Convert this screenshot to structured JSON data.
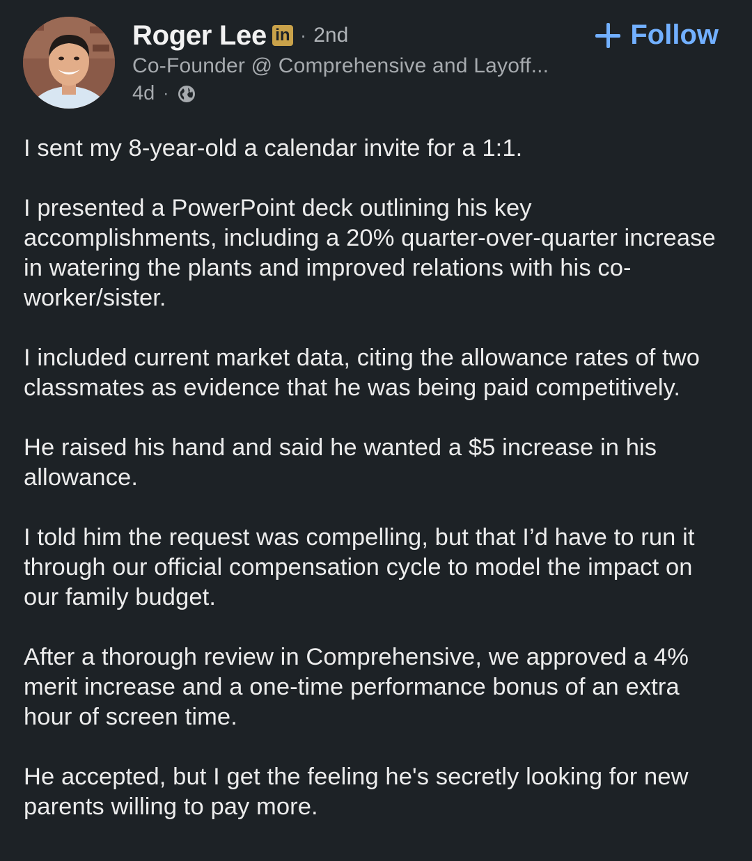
{
  "author": {
    "name": "Roger Lee",
    "badge": "in",
    "degree": "2nd",
    "headline": "Co-Founder @ Comprehensive and Layoff...",
    "time": "4d",
    "visibility_icon": "globe-icon"
  },
  "follow": {
    "label": "Follow",
    "icon": "plus-icon",
    "color": "#72b0ff"
  },
  "separator": "·",
  "post": {
    "paragraphs": [
      "I sent my 8-year-old a calendar invite for a 1:1.",
      "I presented a PowerPoint deck outlining his key accomplishments, including a 20% quarter-over-quarter increase in watering the plants and improved relations with his co-worker/sister.",
      "I included current market data, citing the allowance rates of two classmates as evidence that he was being paid competitively.",
      "He raised his hand and said he wanted a $5 increase in his allowance.",
      "I told him the request was compelling, but that I’d have to run it through our official compensation cycle to model the impact on our family budget.",
      "After a thorough review in Comprehensive, we approved a 4% merit increase and a one-time performance bonus of an extra hour of screen time.",
      "He accepted, but I get the feeling he's secretly looking for new parents willing to pay more."
    ]
  },
  "theme": {
    "background": "#1d2226",
    "text": "#ececec",
    "muted": "#a6aaae",
    "badge_color": "#c9a24a"
  }
}
